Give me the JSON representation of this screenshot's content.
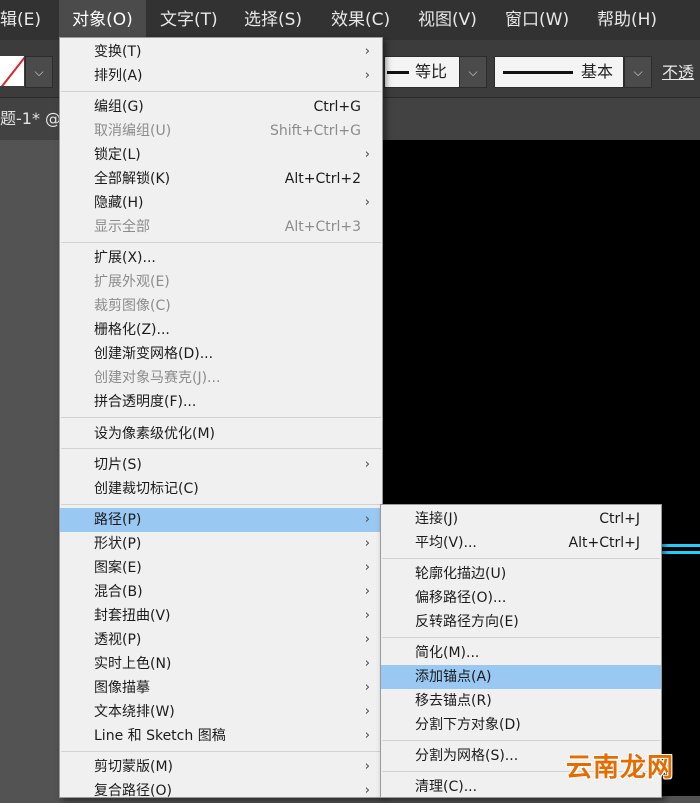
{
  "menubar": {
    "items": [
      "辑(E)",
      "对象(O)",
      "文字(T)",
      "选择(S)",
      "效果(C)",
      "视图(V)",
      "窗口(W)",
      "帮助(H)"
    ]
  },
  "toolbar": {
    "stroke_uniform_label": "等比",
    "stroke_profile_label": "基本",
    "opacity_label": "不透",
    "dropdown_glyph": "⌵"
  },
  "document": {
    "tab_title": "题-1* @"
  },
  "object_menu": {
    "items": [
      {
        "label": "变换(T)",
        "shortcut": "",
        "submenu": true,
        "disabled": false
      },
      {
        "label": "排列(A)",
        "shortcut": "",
        "submenu": true,
        "disabled": false
      },
      {
        "label": "编组(G)",
        "shortcut": "Ctrl+G",
        "submenu": false,
        "disabled": false
      },
      {
        "label": "取消编组(U)",
        "shortcut": "Shift+Ctrl+G",
        "submenu": false,
        "disabled": true
      },
      {
        "label": "锁定(L)",
        "shortcut": "",
        "submenu": true,
        "disabled": false
      },
      {
        "label": "全部解锁(K)",
        "shortcut": "Alt+Ctrl+2",
        "submenu": false,
        "disabled": false
      },
      {
        "label": "隐藏(H)",
        "shortcut": "",
        "submenu": true,
        "disabled": false
      },
      {
        "label": "显示全部",
        "shortcut": "Alt+Ctrl+3",
        "submenu": false,
        "disabled": true
      },
      {
        "label": "扩展(X)...",
        "shortcut": "",
        "submenu": false,
        "disabled": false
      },
      {
        "label": "扩展外观(E)",
        "shortcut": "",
        "submenu": false,
        "disabled": true
      },
      {
        "label": "裁剪图像(C)",
        "shortcut": "",
        "submenu": false,
        "disabled": true
      },
      {
        "label": "栅格化(Z)...",
        "shortcut": "",
        "submenu": false,
        "disabled": false
      },
      {
        "label": "创建渐变网格(D)...",
        "shortcut": "",
        "submenu": false,
        "disabled": false
      },
      {
        "label": "创建对象马赛克(J)...",
        "shortcut": "",
        "submenu": false,
        "disabled": true
      },
      {
        "label": "拼合透明度(F)...",
        "shortcut": "",
        "submenu": false,
        "disabled": false
      },
      {
        "label": "设为像素级优化(M)",
        "shortcut": "",
        "submenu": false,
        "disabled": false
      },
      {
        "label": "切片(S)",
        "shortcut": "",
        "submenu": true,
        "disabled": false
      },
      {
        "label": "创建裁切标记(C)",
        "shortcut": "",
        "submenu": false,
        "disabled": false
      },
      {
        "label": "路径(P)",
        "shortcut": "",
        "submenu": true,
        "disabled": false,
        "highlighted": true
      },
      {
        "label": "形状(P)",
        "shortcut": "",
        "submenu": true,
        "disabled": false
      },
      {
        "label": "图案(E)",
        "shortcut": "",
        "submenu": true,
        "disabled": false
      },
      {
        "label": "混合(B)",
        "shortcut": "",
        "submenu": true,
        "disabled": false
      },
      {
        "label": "封套扭曲(V)",
        "shortcut": "",
        "submenu": true,
        "disabled": false
      },
      {
        "label": "透视(P)",
        "shortcut": "",
        "submenu": true,
        "disabled": false
      },
      {
        "label": "实时上色(N)",
        "shortcut": "",
        "submenu": true,
        "disabled": false
      },
      {
        "label": "图像描摹",
        "shortcut": "",
        "submenu": true,
        "disabled": false
      },
      {
        "label": "文本绕排(W)",
        "shortcut": "",
        "submenu": true,
        "disabled": false
      },
      {
        "label": "Line 和 Sketch 图稿",
        "shortcut": "",
        "submenu": true,
        "disabled": false
      },
      {
        "label": "剪切蒙版(M)",
        "shortcut": "",
        "submenu": true,
        "disabled": false
      },
      {
        "label": "复合路径(O)",
        "shortcut": "",
        "submenu": true,
        "disabled": false
      }
    ]
  },
  "path_submenu": {
    "items": [
      {
        "label": "连接(J)",
        "shortcut": "Ctrl+J"
      },
      {
        "label": "平均(V)...",
        "shortcut": "Alt+Ctrl+J"
      },
      {
        "label": "轮廓化描边(U)",
        "shortcut": ""
      },
      {
        "label": "偏移路径(O)...",
        "shortcut": ""
      },
      {
        "label": "反转路径方向(E)",
        "shortcut": ""
      },
      {
        "label": "简化(M)...",
        "shortcut": ""
      },
      {
        "label": "添加锚点(A)",
        "shortcut": "",
        "highlighted": true
      },
      {
        "label": "移去锚点(R)",
        "shortcut": ""
      },
      {
        "label": "分割下方对象(D)",
        "shortcut": ""
      },
      {
        "label": "分割为网格(S)...",
        "shortcut": ""
      },
      {
        "label": "清理(C)...",
        "shortcut": ""
      }
    ]
  },
  "watermark": {
    "text": "云南龙网"
  },
  "colors": {
    "menu_highlight": "#99c9f2",
    "menubar_bg": "#323232",
    "canvas_bg": "#000000",
    "accent_cyan": "#21cfff",
    "watermark": "#e66b00"
  }
}
